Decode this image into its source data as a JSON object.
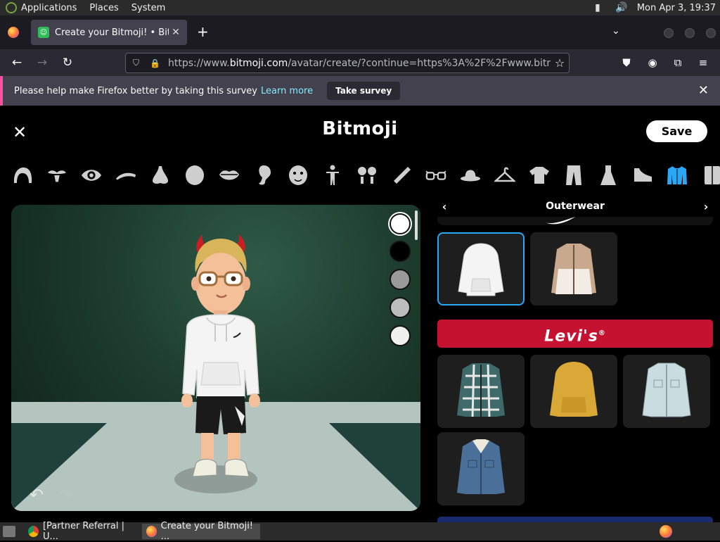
{
  "top_panel": {
    "menus": [
      "Applications",
      "Places",
      "System"
    ],
    "clock": "Mon Apr  3, 19:37"
  },
  "browser": {
    "tab_title": "Create your Bitmoji! • Bitmoji",
    "url_prefix": "https://www.",
    "url_domain": "bitmoji.com",
    "url_rest": "/avatar/create/?continue=https%3A%2F%2Fwww.bitmoji.com%",
    "notice_text": "Please help make Firefox better by taking this survey",
    "notice_link": "Learn more",
    "notice_button": "Take survey"
  },
  "page": {
    "logo": "Bitmoji",
    "save_label": "Save",
    "categories": [
      "hair-icon",
      "facial-hair-icon",
      "eye-icon",
      "eyebrow-icon",
      "nose-icon",
      "face-shape-icon",
      "lips-icon",
      "ear-icon",
      "face-details-icon",
      "body-icon",
      "accessories-icon",
      "makeup-icon",
      "glasses-icon",
      "hat-icon",
      "outfit-icon",
      "top-icon",
      "bottoms-icon",
      "dress-icon",
      "shoes-icon",
      "outerwear-icon",
      "more-icon"
    ],
    "active_category": "outerwear-icon",
    "color_swatches": [
      "#ffffff",
      "#000000",
      "#9a9a9a",
      "#bdbdbd",
      "#f0f0ec"
    ],
    "selected_swatch": 0,
    "panel": {
      "heading": "Outerwear",
      "brand_banner": "Levi's",
      "brand_mark": "®",
      "items_nike": [
        {
          "name": "white-hoodie",
          "color": "#f4f4f4",
          "selected": true
        },
        {
          "name": "tan-windbreaker",
          "color": "#c8a98e",
          "selected": false
        }
      ],
      "items_levis": [
        {
          "name": "plaid-jacket",
          "color": "#3e6b6a"
        },
        {
          "name": "mustard-hoodie",
          "color": "#d9a836"
        },
        {
          "name": "light-denim-jacket",
          "color": "#c9dde0"
        },
        {
          "name": "denim-sherpa-jacket",
          "color": "#4a6f98"
        }
      ]
    }
  },
  "taskbar": {
    "tasks": [
      "[Partner Referral | U...",
      "Create your Bitmoji! ..."
    ]
  }
}
